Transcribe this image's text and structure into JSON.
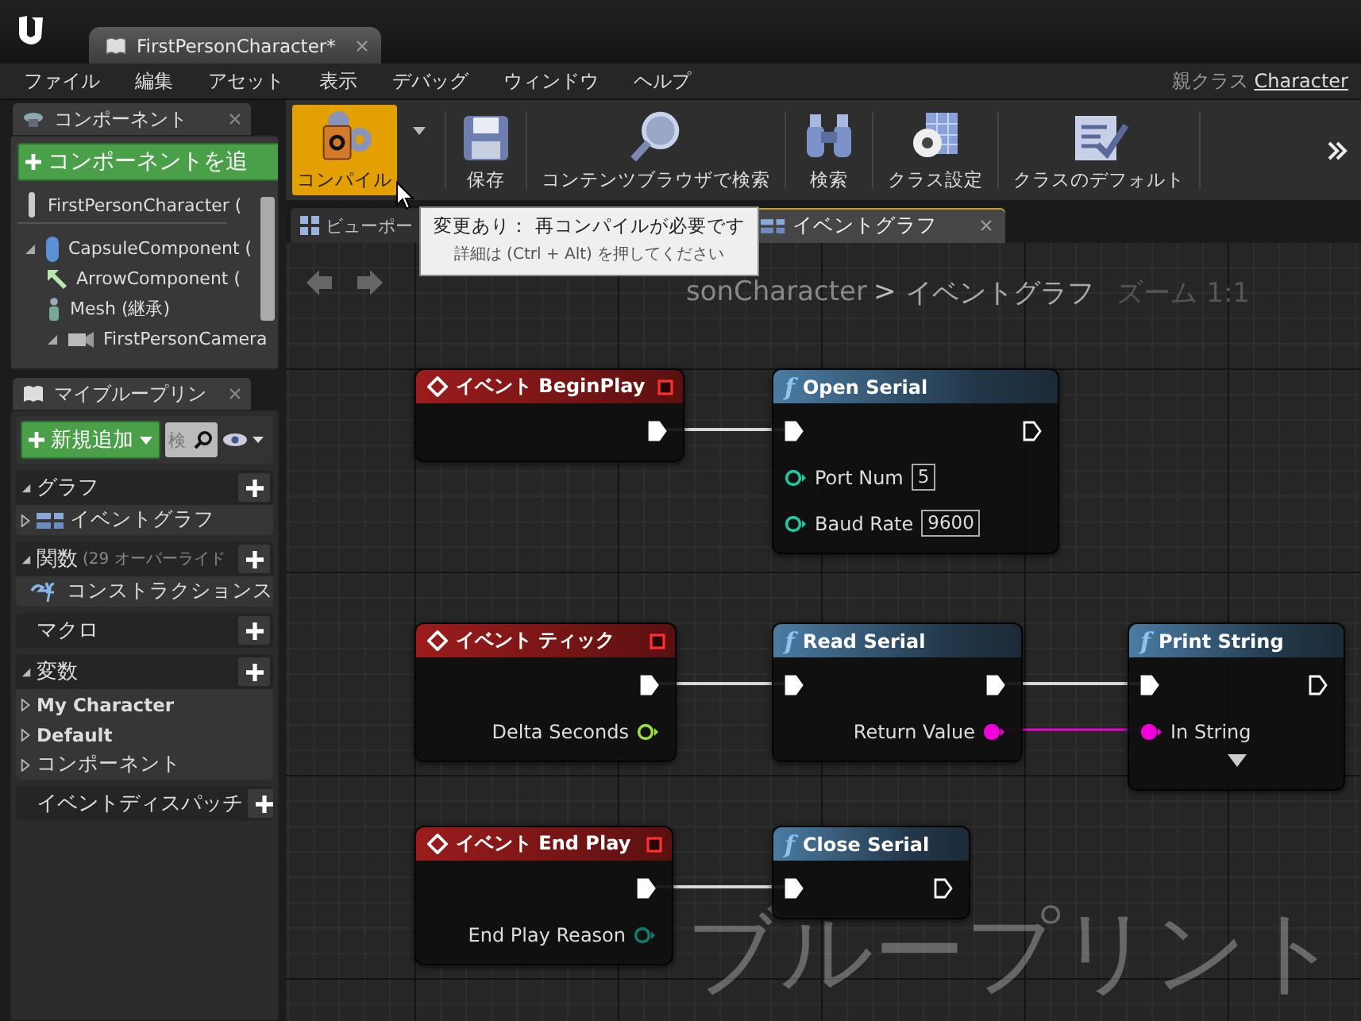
{
  "document_tab": {
    "title": "FirstPersonCharacter*"
  },
  "menu": [
    "ファイル",
    "編集",
    "アセット",
    "表示",
    "デバッグ",
    "ウィンドウ",
    "ヘルプ"
  ],
  "parent_class": {
    "label": "親クラス",
    "value": "Character"
  },
  "components_panel": {
    "title": "コンポーネント",
    "add_button": "コンポーネントを追",
    "tree": [
      {
        "label": "FirstPersonCharacter (",
        "kind": "actor"
      },
      {
        "label": "CapsuleComponent (",
        "kind": "capsule",
        "expanded": true,
        "children": [
          {
            "label": "ArrowComponent (",
            "kind": "arrow"
          },
          {
            "label": "Mesh (継承)",
            "kind": "mesh"
          },
          {
            "label": "FirstPersonCamera",
            "kind": "camera",
            "expanded": true
          }
        ]
      }
    ]
  },
  "my_blueprint_panel": {
    "title": "マイブループリン",
    "new_button": "新規追加",
    "search": {
      "placeholder": "検"
    },
    "sections": [
      {
        "title": "グラフ",
        "expanded": true,
        "items": [
          {
            "label": "イベントグラフ",
            "kind": "graph",
            "expanded": false
          }
        ]
      },
      {
        "title": "関数",
        "note": "(29 オーバーライド",
        "expanded": true,
        "items": [
          {
            "label": "コンストラクションス",
            "kind": "function"
          }
        ]
      },
      {
        "title": "マクロ"
      },
      {
        "title": "変数",
        "expanded": true,
        "items": [
          {
            "label": "My Character",
            "kind": "category",
            "expanded": false,
            "emphasized": true
          },
          {
            "label": "Default",
            "kind": "category",
            "expanded": false,
            "emphasized": true
          },
          {
            "label": "コンポーネント",
            "kind": "category",
            "expanded": false,
            "emphasized": false
          }
        ]
      },
      {
        "title": "イベントディスパッチ"
      }
    ]
  },
  "toolbar": [
    {
      "kind": "compile",
      "label": "コンパイル",
      "highlighted": true
    },
    {
      "kind": "save",
      "label": "保存",
      "highlighted": false
    },
    {
      "kind": "browse",
      "label": "コンテンツブラウザで検索",
      "highlighted": false
    },
    {
      "kind": "search",
      "label": "検索",
      "highlighted": false
    },
    {
      "kind": "settings",
      "label": "クラス設定",
      "highlighted": false
    },
    {
      "kind": "defaults",
      "label": "クラスのデフォルト",
      "highlighted": false
    }
  ],
  "tabs": [
    {
      "label": "ビューポー",
      "kind": "viewport",
      "selected": false
    },
    {
      "label": "イベントグラフ",
      "kind": "graph",
      "selected": true,
      "closable": true
    }
  ],
  "tooltip": {
    "title": "変更あり： 再コンパイルが必要です",
    "detail": "詳細は (Ctrl + Alt) を押してください"
  },
  "breadcrumb": {
    "path": "sonCharacter",
    "separator": ">",
    "current": "イベントグラフ",
    "zoom": "ズーム 1:1"
  },
  "graph": {
    "watermark": "ブループリント",
    "chains": [
      [
        {
          "kind": "event",
          "title": "イベント BeginPlay",
          "rows": [
            {
              "out": {
                "kind": "exec",
                "connected": true
              }
            }
          ]
        },
        {
          "kind": "function",
          "glyph": "f",
          "title": "Open Serial",
          "rows": [
            {
              "in": {
                "kind": "exec",
                "connected": true
              },
              "out": {
                "kind": "exec",
                "connected": false
              }
            },
            {
              "in": {
                "kind": "data",
                "label": "Port Num",
                "value": "5",
                "color": "#1fc9a0",
                "connected": false
              }
            },
            {
              "in": {
                "kind": "data",
                "label": "Baud Rate",
                "value": "9600",
                "color": "#1fc9a0",
                "connected": false
              }
            }
          ]
        }
      ],
      [
        {
          "kind": "event",
          "title": "イベント ティック",
          "rows": [
            {
              "out": {
                "kind": "exec",
                "connected": true
              }
            },
            {
              "out": {
                "kind": "data",
                "label": "Delta Seconds",
                "color": "#9be03a",
                "connected": false
              }
            }
          ]
        },
        {
          "kind": "function",
          "glyph": "f",
          "title": "Read Serial",
          "rows": [
            {
              "in": {
                "kind": "exec",
                "connected": true
              },
              "out": {
                "kind": "exec",
                "connected": true
              }
            },
            {
              "out": {
                "kind": "data",
                "label": "Return Value",
                "color": "#f000d8",
                "connected": true
              }
            }
          ]
        },
        {
          "kind": "function",
          "glyph": "f",
          "title": "Print String",
          "advanced": true,
          "rows": [
            {
              "in": {
                "kind": "exec",
                "connected": true
              },
              "out": {
                "kind": "exec",
                "connected": false
              }
            },
            {
              "in": {
                "kind": "data",
                "label": "In String",
                "color": "#f000d8",
                "connected": true
              }
            }
          ]
        }
      ],
      [
        {
          "kind": "event",
          "title": "イベント End Play",
          "rows": [
            {
              "out": {
                "kind": "exec",
                "connected": true
              }
            },
            {
              "out": {
                "kind": "data",
                "label": "End Play Reason",
                "color": "#0e7d6a",
                "connected": false
              }
            }
          ]
        },
        {
          "kind": "function",
          "glyph": "f",
          "title": "Close Serial",
          "rows": [
            {
              "in": {
                "kind": "exec",
                "connected": true
              },
              "out": {
                "kind": "exec",
                "connected": false
              }
            }
          ]
        }
      ]
    ]
  }
}
